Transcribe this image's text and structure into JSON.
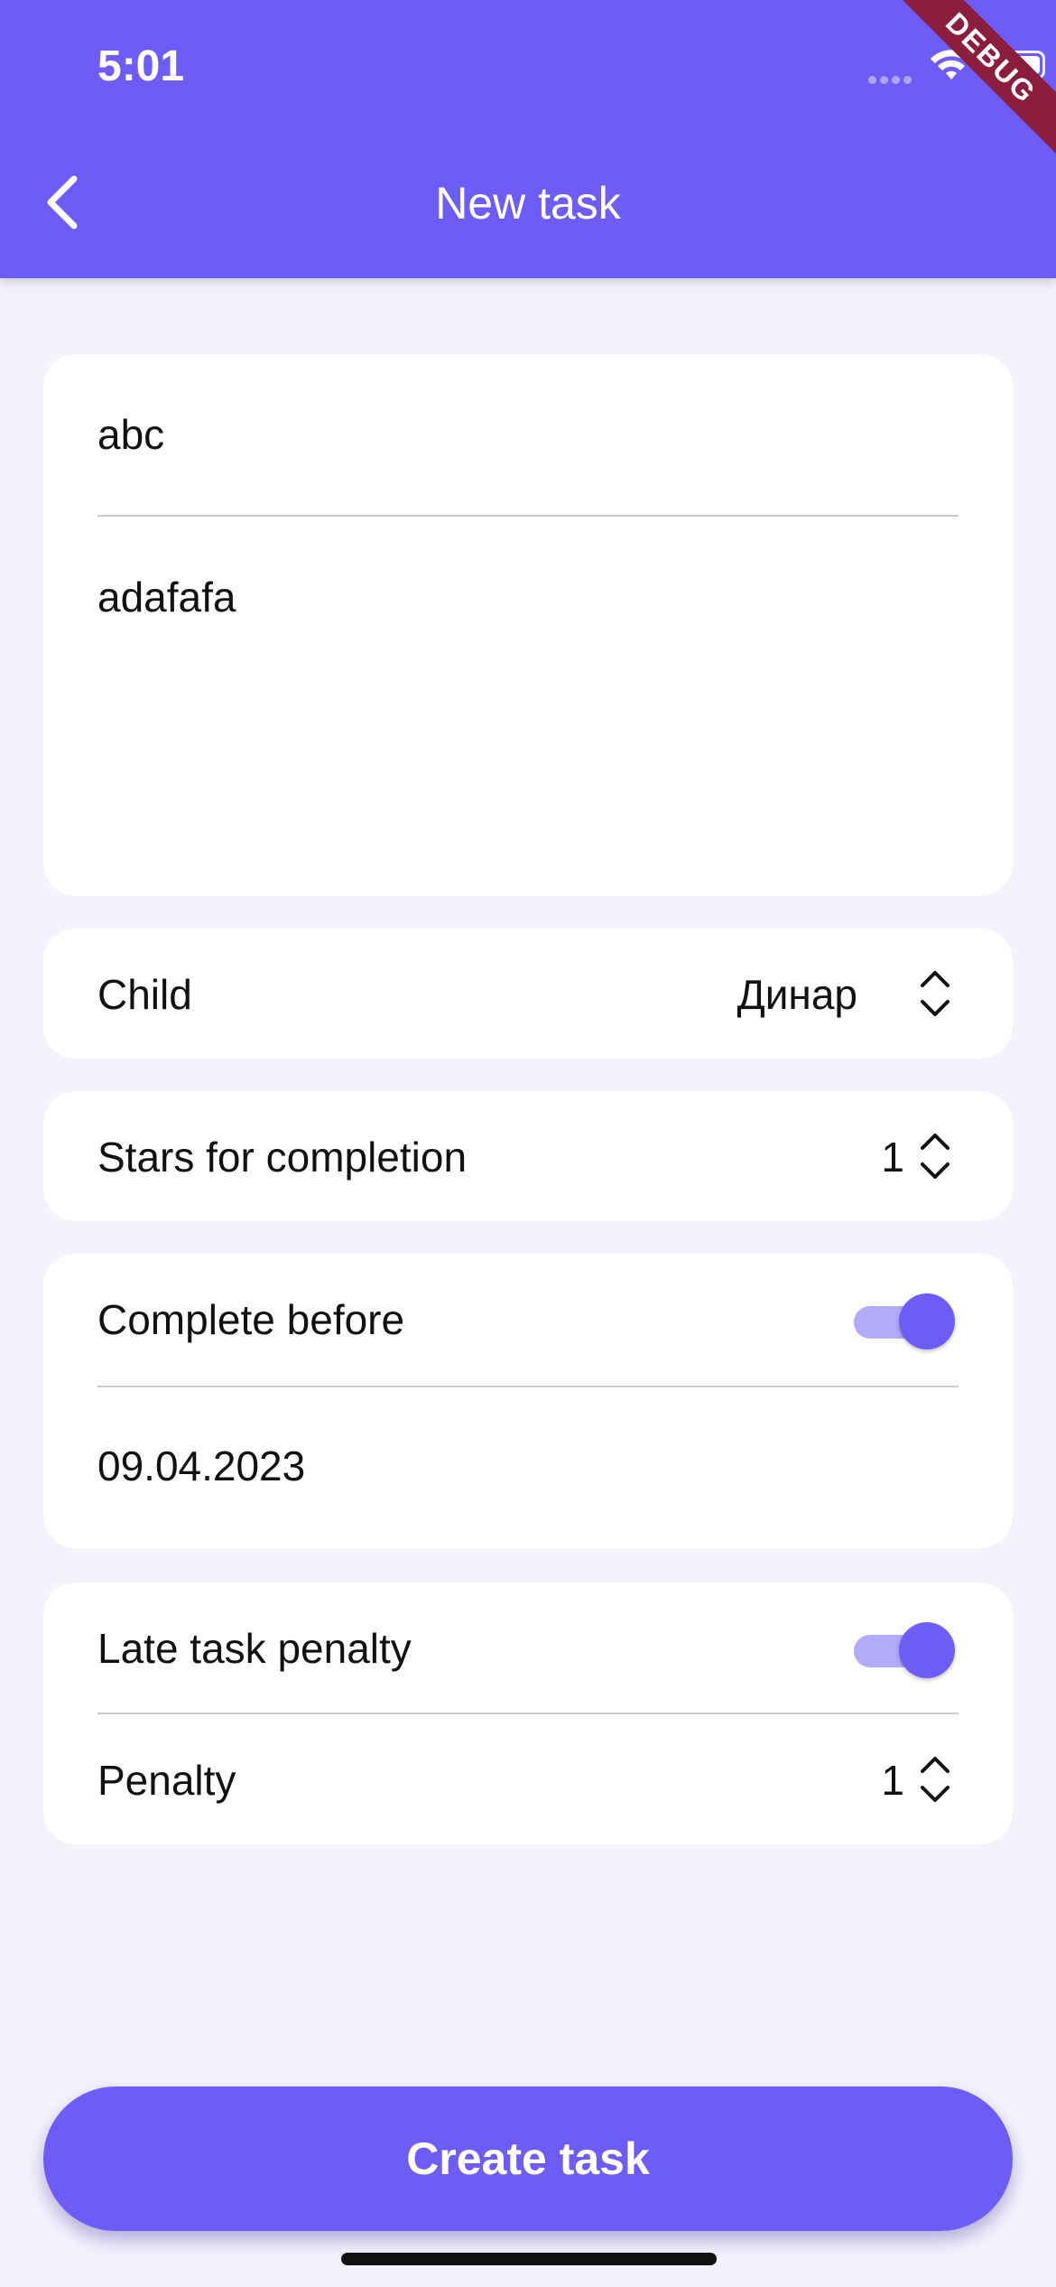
{
  "status_bar": {
    "time": "5:01",
    "debug_label": "DEBUG"
  },
  "header": {
    "title": "New task",
    "back_icon": "chevron-left-icon"
  },
  "task_form": {
    "title_value": "abc",
    "description_value": "adafafa"
  },
  "child_row": {
    "label": "Child",
    "value": "Динар",
    "icon": "chevron-up-down-icon"
  },
  "stars_row": {
    "label": "Stars for completion",
    "value": "1",
    "icon": "chevron-up-down-icon"
  },
  "deadline": {
    "label": "Complete before",
    "enabled": true,
    "date": "09.04.2023"
  },
  "penalty_section": {
    "toggle_label": "Late task penalty",
    "enabled": true,
    "penalty_label": "Penalty",
    "penalty_value": "1"
  },
  "create_button": {
    "label": "Create task"
  },
  "colors": {
    "accent": "#6d5cf6",
    "background": "#f4f3fd",
    "toggle_track": "#b3abf7",
    "debug_ribbon": "#8b1e3f"
  }
}
